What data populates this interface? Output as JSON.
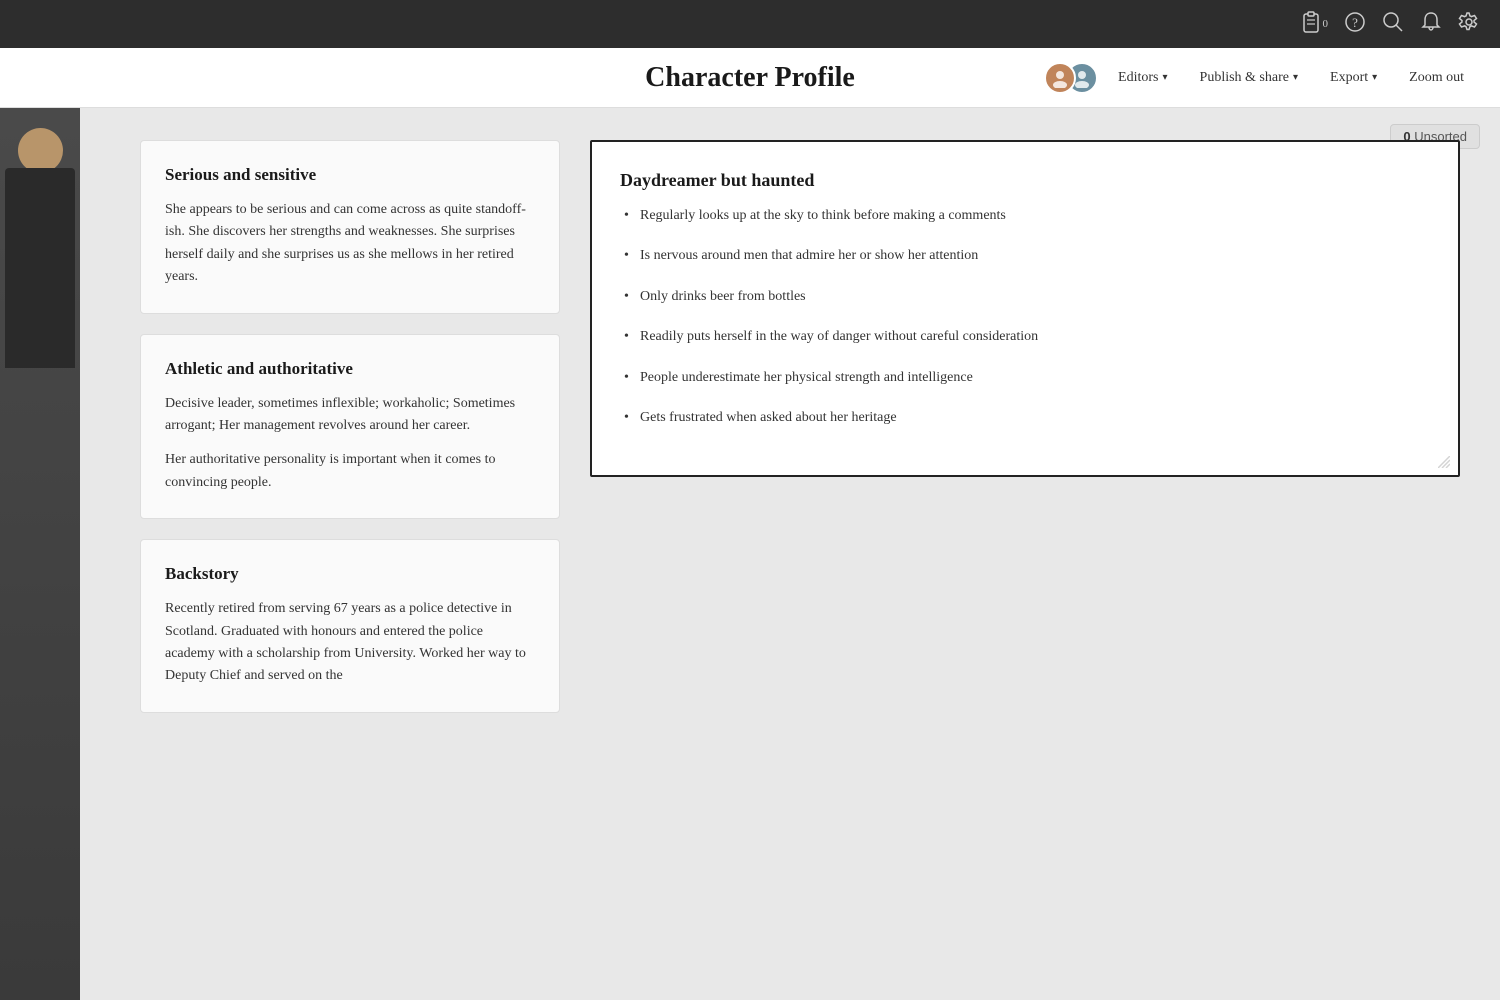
{
  "topbar": {
    "clipboard_count": "0",
    "icons": [
      "clipboard-icon",
      "help-icon",
      "search-icon",
      "bell-icon",
      "settings-icon"
    ]
  },
  "header": {
    "title": "Character Profile",
    "editors_label": "Editors",
    "publish_label": "Publish & share",
    "export_label": "Export",
    "zoom_label": "Zoom out"
  },
  "unsorted": {
    "count": "0",
    "label": "Unsorted"
  },
  "cards": {
    "serious": {
      "title": "Serious and sensitive",
      "text": "She appears to be serious and can come across as quite standoff-ish. She discovers her strengths and weaknesses. She surprises herself daily and she surprises us as she mellows in her retired years."
    },
    "athletic": {
      "title": "Athletic and authoritative",
      "text1": "Decisive leader, sometimes inflexible; workaholic; Sometimes arrogant; Her management revolves around her career.",
      "text2": "Her authoritative personality is important when it comes to convincing people."
    },
    "backstory": {
      "title": "Backstory",
      "text": "Recently retired from serving 67 years as a police detective in Scotland. Graduated with honours and entered the police academy with a scholarship from University. Worked her way to Deputy Chief and served on the"
    },
    "daydreamer": {
      "title": "Daydreamer but haunted",
      "bullets": [
        "Regularly looks up at the sky to think before making a comments",
        "Is nervous around men that admire her or show her attention",
        "Only drinks beer from bottles",
        "Readily puts herself in the way of danger without careful consideration",
        "People underestimate her physical strength and intelligence",
        "Gets frustrated when asked about her heritage"
      ]
    }
  }
}
